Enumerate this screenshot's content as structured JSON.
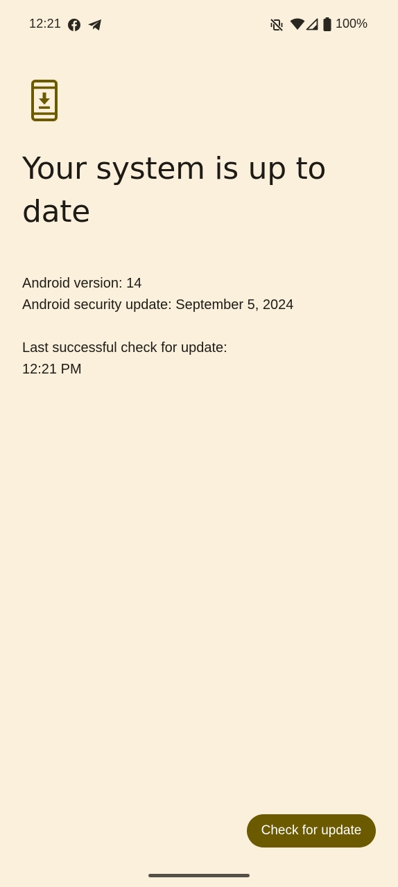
{
  "status_bar": {
    "time": "12:21",
    "notification_icons": [
      "facebook-icon",
      "telegram-icon"
    ],
    "system_icons": [
      "vibrate-off-icon",
      "wifi-icon",
      "signal-icon",
      "battery-icon"
    ],
    "battery": "100%"
  },
  "main": {
    "icon": "phone-download-icon",
    "title": "Your system is up to date",
    "android_version": "Android version: 14",
    "security_update": "Android security update: September 5, 2024",
    "last_check_label": "Last successful check for update:",
    "last_check_time": "12:21 PM"
  },
  "actions": {
    "check_button": "Check for update"
  },
  "colors": {
    "background": "#fbf0dc",
    "accent": "#6b5a00",
    "text": "#1e1b16"
  }
}
